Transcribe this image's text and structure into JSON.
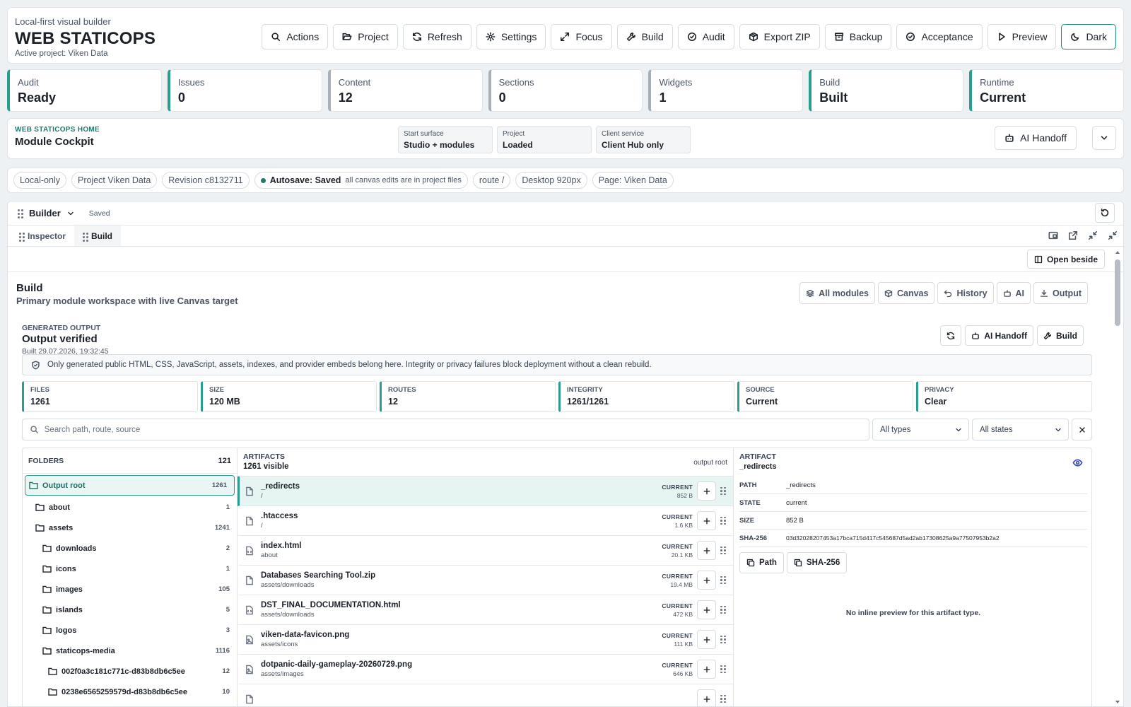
{
  "header": {
    "subtitle": "Local-first visual builder",
    "title": "WEB STATICOPS",
    "active_project": "Active project: Viken Data",
    "buttons": [
      {
        "label": "Actions",
        "icon": "search-icon"
      },
      {
        "label": "Project",
        "icon": "folder-open-icon"
      },
      {
        "label": "Refresh",
        "icon": "refresh-icon"
      },
      {
        "label": "Settings",
        "icon": "gear-icon"
      },
      {
        "label": "Focus",
        "icon": "expand-icon"
      },
      {
        "label": "Build",
        "icon": "wrench-icon"
      },
      {
        "label": "Audit",
        "icon": "check-circle-icon"
      },
      {
        "label": "Export ZIP",
        "icon": "package-icon"
      },
      {
        "label": "Backup",
        "icon": "archive-icon"
      },
      {
        "label": "Acceptance",
        "icon": "check-circle-icon"
      },
      {
        "label": "Preview",
        "icon": "play-icon"
      },
      {
        "label": "Dark",
        "icon": "moon-icon"
      }
    ]
  },
  "stats": [
    {
      "label": "Audit",
      "value": "Ready"
    },
    {
      "label": "Issues",
      "value": "0"
    },
    {
      "label": "Content",
      "value": "12"
    },
    {
      "label": "Sections",
      "value": "0"
    },
    {
      "label": "Widgets",
      "value": "1"
    },
    {
      "label": "Build",
      "value": "Built"
    },
    {
      "label": "Runtime",
      "value": "Current"
    }
  ],
  "home": {
    "kicker": "WEB STATICOPS HOME",
    "title": "Module Cockpit",
    "chips": [
      {
        "key": "Start surface",
        "value": "Studio + modules"
      },
      {
        "key": "Project",
        "value": "Loaded"
      },
      {
        "key": "Client service",
        "value": "Client Hub only"
      }
    ],
    "handoff_label": "AI Handoff"
  },
  "pills": {
    "local": "Local-only",
    "project": "Project Viken Data",
    "revision": "Revision c8132711",
    "autosave_label": "Autosave: Saved",
    "autosave_note": "all canvas edits are in project files",
    "route": "route /",
    "viewport": "Desktop 920px",
    "page": "Page: Viken Data"
  },
  "builder": {
    "title": "Builder",
    "saved": "Saved",
    "tabs": [
      {
        "label": "Inspector"
      },
      {
        "label": "Build"
      }
    ],
    "open_beside": "Open beside",
    "section_title": "Build",
    "section_sub": "Primary module workspace with live Canvas target",
    "module_buttons": [
      {
        "label": "All modules",
        "icon": "layers-icon"
      },
      {
        "label": "Canvas",
        "icon": "cube-icon"
      },
      {
        "label": "History",
        "icon": "undo-icon"
      },
      {
        "label": "AI",
        "icon": "robot-icon"
      },
      {
        "label": "Output",
        "icon": "download-icon"
      }
    ]
  },
  "output": {
    "kicker": "GENERATED OUTPUT",
    "title": "Output verified",
    "built": "Built 29.07.2026, 19:32:45",
    "handoff_label": "AI Handoff",
    "build_label": "Build",
    "notice": "Only generated public HTML, CSS, JavaScript, assets, indexes, and provider embeds belong here. Integrity or privacy failures block deployment without a clean rebuild.",
    "metrics": [
      {
        "key": "FILES",
        "value": "1261"
      },
      {
        "key": "SIZE",
        "value": "120 MB"
      },
      {
        "key": "ROUTES",
        "value": "12"
      },
      {
        "key": "INTEGRITY",
        "value": "1261/1261"
      },
      {
        "key": "SOURCE",
        "value": "Current"
      },
      {
        "key": "PRIVACY",
        "value": "Clear"
      }
    ],
    "search_placeholder": "Search path, route, source",
    "type_filter": "All types",
    "state_filter": "All states"
  },
  "folders": {
    "header": "FOLDERS",
    "count": "121",
    "items": [
      {
        "name": "Output root",
        "count": "1261",
        "depth": 0,
        "selected": true
      },
      {
        "name": "about",
        "count": "1",
        "depth": 1
      },
      {
        "name": "assets",
        "count": "1241",
        "depth": 1
      },
      {
        "name": "downloads",
        "count": "2",
        "depth": 2
      },
      {
        "name": "icons",
        "count": "1",
        "depth": 2
      },
      {
        "name": "images",
        "count": "105",
        "depth": 2
      },
      {
        "name": "islands",
        "count": "5",
        "depth": 2
      },
      {
        "name": "logos",
        "count": "3",
        "depth": 2
      },
      {
        "name": "staticops-media",
        "count": "1116",
        "depth": 2
      },
      {
        "name": "002f0a3c181c771c-d83b8db6c5ee",
        "count": "12",
        "depth": 3
      },
      {
        "name": "0238e6565259579d-d83b8db6c5ee",
        "count": "10",
        "depth": 3
      }
    ]
  },
  "artifacts": {
    "header": "ARTIFACTS",
    "count_label": "1261 visible",
    "root_label": "output root",
    "items": [
      {
        "name": "_redirects",
        "path": "/",
        "state": "CURRENT",
        "size": "852 B",
        "icon": "file-icon",
        "selected": true
      },
      {
        "name": ".htaccess",
        "path": "/",
        "state": "CURRENT",
        "size": "1.6 KB",
        "icon": "file-icon"
      },
      {
        "name": "index.html",
        "path": "about",
        "state": "CURRENT",
        "size": "20.1 KB",
        "icon": "code-file-icon"
      },
      {
        "name": "Databases Searching Tool.zip",
        "path": "assets/downloads",
        "state": "CURRENT",
        "size": "19.4 MB",
        "icon": "file-icon"
      },
      {
        "name": "DST_FINAL_DOCUMENTATION.html",
        "path": "assets/downloads",
        "state": "CURRENT",
        "size": "472 KB",
        "icon": "code-file-icon"
      },
      {
        "name": "viken-data-favicon.png",
        "path": "assets/icons",
        "state": "CURRENT",
        "size": "111 KB",
        "icon": "image-file-icon"
      },
      {
        "name": "dotpanic-daily-gameplay-20260729.png",
        "path": "assets/images",
        "state": "CURRENT",
        "size": "646 KB",
        "icon": "image-file-icon"
      },
      {
        "name": "",
        "path": "",
        "state": "",
        "size": "",
        "icon": "file-icon"
      }
    ]
  },
  "artifact_detail": {
    "header": "ARTIFACT",
    "name": "_redirects",
    "rows": [
      {
        "key": "PATH",
        "value": "_redirects"
      },
      {
        "key": "STATE",
        "value": "current"
      },
      {
        "key": "SIZE",
        "value": "852 B"
      },
      {
        "key": "SHA-256",
        "value": "03d32028207453a17bca715d417c545687d5ad2ab17308625a9a77507953b2a2"
      }
    ],
    "copy_path": "Path",
    "copy_sha": "SHA-256",
    "no_preview": "No inline preview for this artifact type."
  },
  "colors": {
    "accent": "#2a9d8f",
    "accent_dark": "#1f7a6f",
    "eye": "#3a4bb5"
  }
}
